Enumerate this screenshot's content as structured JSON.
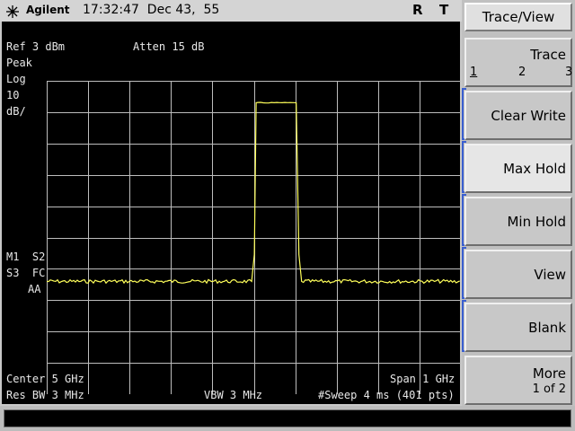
{
  "header": {
    "brand": "Agilent",
    "time": "17:32:47",
    "date": "Dec 43,  55",
    "flag_r": "R",
    "flag_t": "T"
  },
  "display": {
    "ref_level": "Ref 3 dBm",
    "attenuation": "Atten 15 dB",
    "detector": "Peak",
    "scale_type": "Log",
    "scale_value": "10",
    "scale_unit": "dB/",
    "trace_mode_1": "M1  S2",
    "trace_mode_2": "S3  FC",
    "trace_mode_3": "AA",
    "center": "Center 5 GHz",
    "span": "Span 1 GHz",
    "res_bw": "Res BW 3 MHz",
    "vbw": "VBW 3 MHz",
    "sweep": "#Sweep 4 ms (401 pts)"
  },
  "trace_data": {
    "color": "#ffff5a",
    "grid_color": "#bdbdbd",
    "noise_floor_db_below_ref": 64,
    "pulse_top_db_below_ref": 7,
    "pulse_start_fraction": 0.497,
    "pulse_end_fraction": 0.611
  },
  "softkeys": {
    "title": "Trace/View",
    "trace_label": "Trace",
    "trace_options": [
      "1",
      "2",
      "3"
    ],
    "clear_write": "Clear Write",
    "max_hold": "Max Hold",
    "min_hold": "Min Hold",
    "view": "View",
    "blank": "Blank",
    "more": "More",
    "more_page": "1 of 2"
  }
}
